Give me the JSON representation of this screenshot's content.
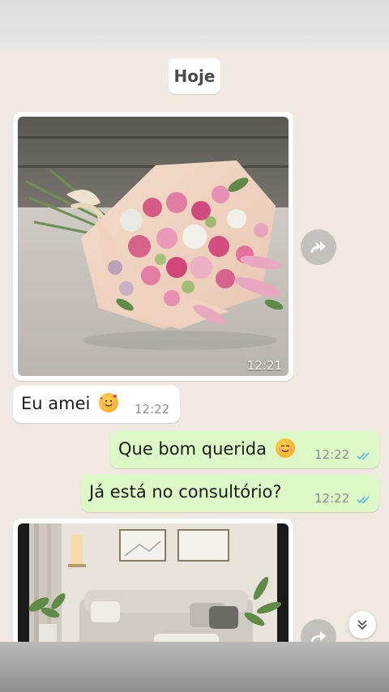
{
  "chat": {
    "date_label": "Hoje",
    "messages": [
      {
        "kind": "image",
        "direction": "incoming",
        "subject": "flower bouquet",
        "time": "12:21"
      },
      {
        "kind": "text",
        "direction": "incoming",
        "text": "Eu amei",
        "emoji": "smiling-face-with-hearts",
        "time": "12:22"
      },
      {
        "kind": "text",
        "direction": "outgoing",
        "text": "Que bom querida",
        "emoji": "smiling-face",
        "time": "12:22",
        "status": "read"
      },
      {
        "kind": "text",
        "direction": "outgoing",
        "text": "Já está no consultório?",
        "time": "12:22",
        "status": "read"
      },
      {
        "kind": "image",
        "direction": "incoming",
        "subject": "living room",
        "time": ""
      }
    ]
  },
  "icons": {
    "forward": "forward-icon",
    "scroll_down": "double-chevron-down-icon",
    "read_receipt": "double-check-icon"
  },
  "colors": {
    "chat_background": "#efe9e1",
    "incoming_bubble": "#ffffff",
    "outgoing_bubble": "#dcf8c6",
    "read_tick": "#4fb6ec"
  }
}
